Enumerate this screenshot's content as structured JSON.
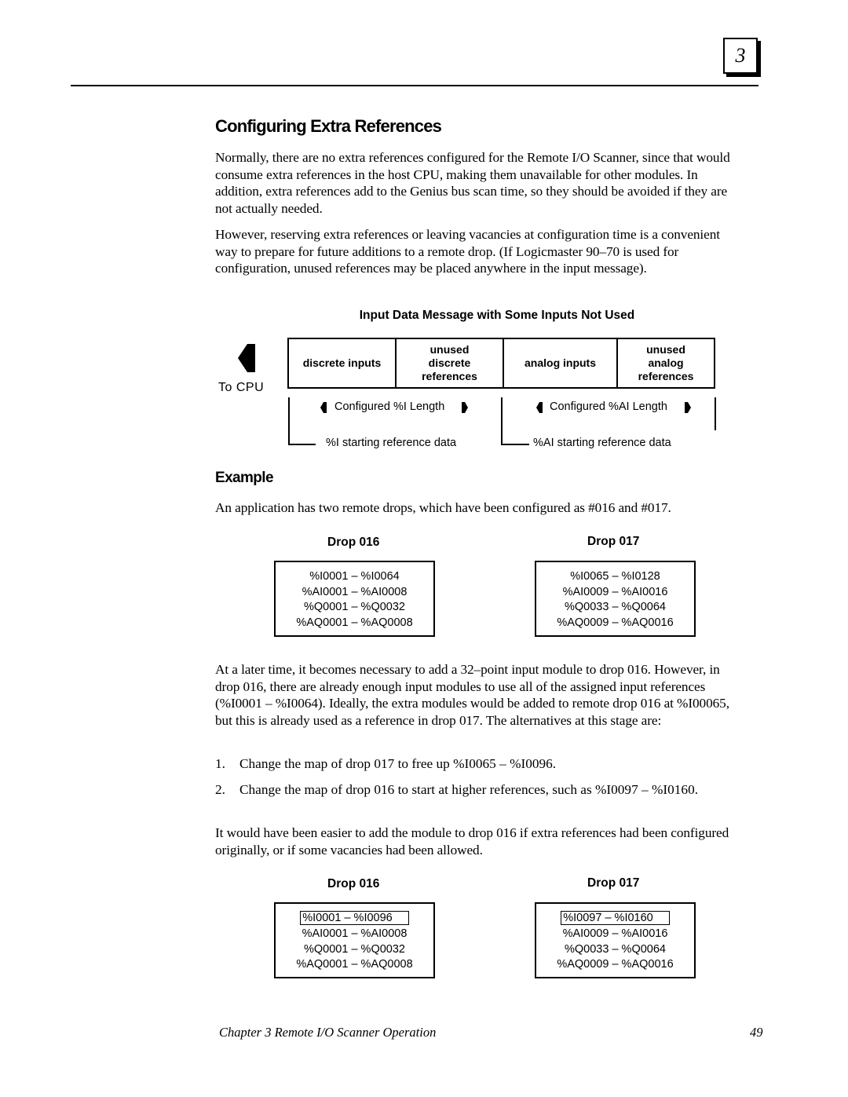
{
  "chapter_tab": "3",
  "title": "Configuring Extra References",
  "paragraphs": {
    "p1": "Normally, there are no extra references configured for the Remote I/O Scanner, since that would consume extra references in the host CPU, making them unavailable for other modules.  In addition, extra references add to the Genius bus scan time, so they should be avoided if they are not actually needed.",
    "p2": "However, reserving extra references or leaving vacancies  at configuration time is a convenient way to prepare for future additions to a remote drop.  (If Logicmaster 90–70 is used for configuration, unused references may be placed anywhere in the input message).",
    "p3": "An application has two remote drops, which have been configured as #016 and #017.",
    "p4": "At a later time, it becomes necessary to add a 32–point input module to drop 016. However, in drop 016, there are already enough input modules to use all of the assigned input references (%I0001 – %I0064).  Ideally, the extra modules would be added to remote drop 016 at %I00065, but this is already used as a reference in drop 017.  The alternatives at this stage are:",
    "p5": "It would have been easier to add the module to drop 016 if extra references had been configured originally, or if some vacancies had been allowed."
  },
  "list": [
    {
      "num": "1.",
      "text": "Change the map of drop 017 to free up %I0065 – %I0096."
    },
    {
      "num": "2.",
      "text": "Change the map of drop 016 to start at higher references, such as %I0097 – %I0160."
    }
  ],
  "diagram": {
    "title": "Input  Data Message with Some Inputs Not Used",
    "to_cpu": "To  CPU",
    "cells": [
      {
        "lines": [
          "discrete inputs"
        ]
      },
      {
        "lines": [
          "unused",
          "discrete",
          "references"
        ]
      },
      {
        "lines": [
          "analog inputs"
        ]
      },
      {
        "lines": [
          "unused",
          "analog",
          "references"
        ]
      }
    ],
    "configured_i_length": "Configured %I Length",
    "configured_ai_length": "Configured %AI Length",
    "i_start": "%I starting reference data",
    "ai_start": "%AI starting reference data"
  },
  "example_heading": "Example",
  "drops_before": [
    {
      "title": "Drop 016",
      "lines": [
        "%I0001 – %I0064",
        "%AI0001 – %AI0008",
        "%Q0001 – %Q0032",
        "%AQ0001 – %AQ0008"
      ]
    },
    {
      "title": "Drop 017",
      "lines": [
        "%I0065 – %I0128",
        "%AI0009 – %AI0016",
        "%Q0033 – %Q0064",
        "%AQ0009 – %AQ0016"
      ]
    }
  ],
  "drops_after": [
    {
      "title": "Drop 016",
      "lines": [
        "%I0001 – %I0096",
        "%AI0001 – %AI0008",
        "%Q0001 – %Q0032",
        "%AQ0001 – %AQ0008"
      ],
      "highlighted_line": 0
    },
    {
      "title": "Drop 017",
      "lines": [
        "%I0097 – %I0160",
        "%AI0009 – %AI0016",
        "%Q0033 – %Q0064",
        "%AQ0009 – %AQ0016"
      ],
      "highlighted_line": 0
    }
  ],
  "footer": {
    "chapter": "Chapter 3  Remote I/O Scanner Operation",
    "page": "49"
  }
}
